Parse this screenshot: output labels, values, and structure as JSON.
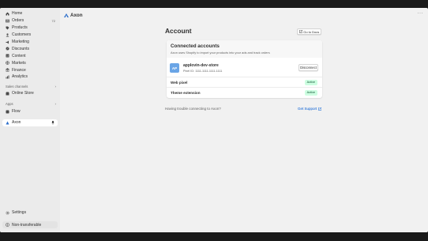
{
  "sidebar": {
    "items": [
      {
        "label": "Home",
        "icon": "home-icon",
        "badge": ""
      },
      {
        "label": "Orders",
        "icon": "orders-icon",
        "badge": "72"
      },
      {
        "label": "Products",
        "icon": "products-icon",
        "badge": ""
      },
      {
        "label": "Customers",
        "icon": "customers-icon",
        "badge": ""
      },
      {
        "label": "Marketing",
        "icon": "marketing-icon",
        "badge": ""
      },
      {
        "label": "Discounts",
        "icon": "discounts-icon",
        "badge": ""
      },
      {
        "label": "Content",
        "icon": "content-icon",
        "badge": ""
      },
      {
        "label": "Markets",
        "icon": "globe-icon",
        "badge": ""
      },
      {
        "label": "Finance",
        "icon": "finance-icon",
        "badge": ""
      },
      {
        "label": "Analytics",
        "icon": "analytics-icon",
        "badge": ""
      }
    ],
    "sales_channels_label": "Sales channels",
    "online_store_label": "Online Store",
    "apps_label": "Apps",
    "flow_label": "Flow",
    "axon_label": "Axon",
    "settings_label": "Settings",
    "non_transferable_label": "Non-transferable"
  },
  "topbar": {
    "app_name": "Axon"
  },
  "page": {
    "title": "Account",
    "docs_button": "Go to Docs"
  },
  "card": {
    "title": "Connected accounts",
    "subtitle": "Axon uses Shopify to import your products into your ads and track orders",
    "account": {
      "initials": "AP",
      "name": "applovin-dev-store",
      "pixel_id": "Pixel ID: 1111-1111-1111-1111",
      "disconnect_label": "Disconnect"
    },
    "rows": [
      {
        "label": "Web pixel",
        "status": "Active"
      },
      {
        "label": "Theme extension",
        "status": "Active"
      }
    ]
  },
  "help": {
    "text": "Having trouble connecting to Axon?",
    "support_link": "Get Support"
  },
  "colors": {
    "accent_blue": "#005bd3",
    "status_green_bg": "#cdfee1",
    "status_green_text": "#0c5132",
    "avatar_blue": "#6aa5e6"
  }
}
